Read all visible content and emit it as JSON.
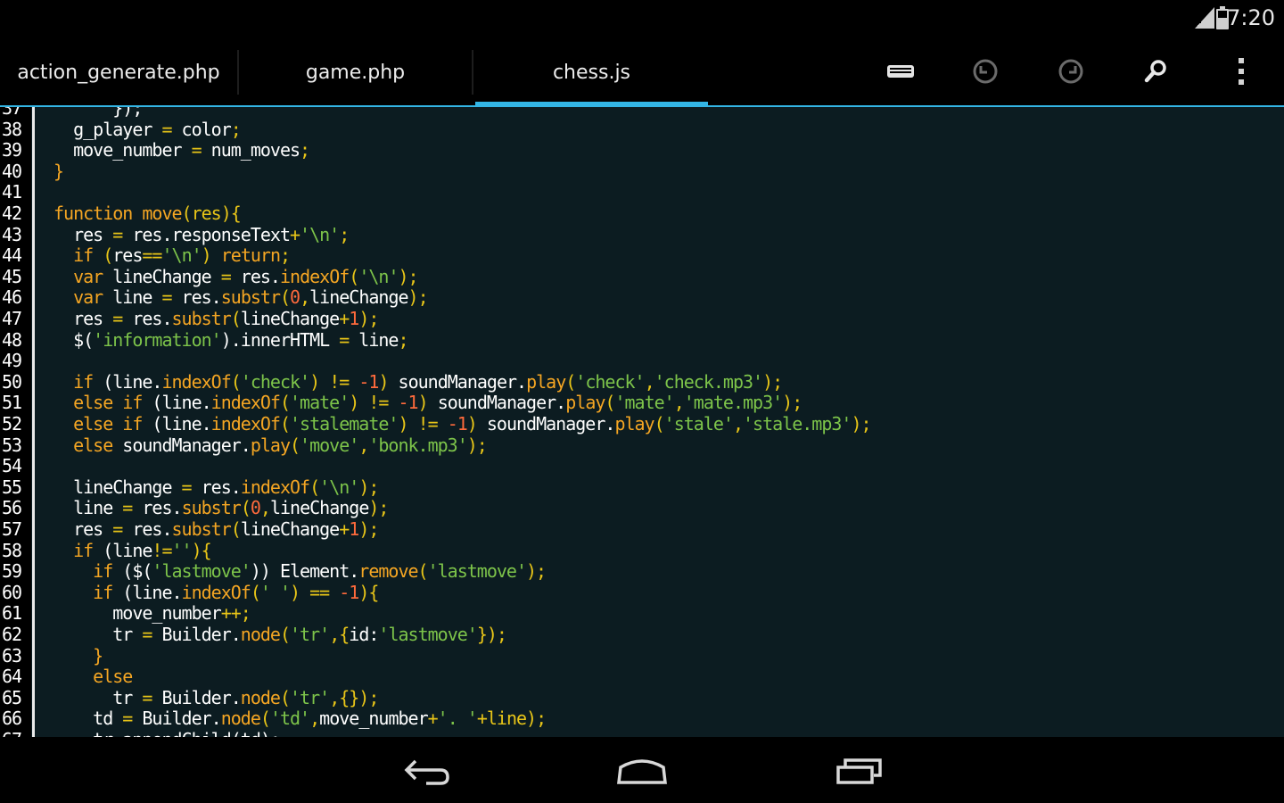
{
  "status_bar": {
    "time": "7:20"
  },
  "tabs": [
    {
      "label": "action_generate.php"
    },
    {
      "label": "game.php"
    },
    {
      "label": "chess.js"
    }
  ],
  "toolbar_icons": [
    "keyboard-icon",
    "undo-icon",
    "redo-icon",
    "search-icon",
    "overflow-menu-icon"
  ],
  "colors": {
    "accent": "#33b5e5",
    "editor_bg": "#0c1c21",
    "keyword": "#f5a623",
    "string": "#7dc44a",
    "number": "#ff6a3c"
  },
  "editor": {
    "file": "chess.js",
    "lines": [
      {
        "n": "37",
        "tokens": [
          {
            "t": "      });",
            "c": "t-p"
          }
        ]
      },
      {
        "n": "38",
        "tokens": [
          {
            "t": "  g_player ",
            "c": "t-p"
          },
          {
            "t": "=",
            "c": "t-op"
          },
          {
            "t": " color",
            "c": "t-p"
          },
          {
            "t": ";",
            "c": "t-op"
          }
        ]
      },
      {
        "n": "39",
        "tokens": [
          {
            "t": "  move_number ",
            "c": "t-p"
          },
          {
            "t": "=",
            "c": "t-op"
          },
          {
            "t": " num_moves",
            "c": "t-p"
          },
          {
            "t": ";",
            "c": "t-op"
          }
        ]
      },
      {
        "n": "40",
        "tokens": [
          {
            "t": "}",
            "c": "t-kw"
          }
        ]
      },
      {
        "n": "41",
        "tokens": []
      },
      {
        "n": "42",
        "tokens": [
          {
            "t": "function",
            "c": "t-kw"
          },
          {
            "t": " ",
            "c": "t-p"
          },
          {
            "t": "move",
            "c": "t-m"
          },
          {
            "t": "(res){",
            "c": "t-op"
          }
        ]
      },
      {
        "n": "43",
        "tokens": [
          {
            "t": "  res ",
            "c": "t-p"
          },
          {
            "t": "=",
            "c": "t-op"
          },
          {
            "t": " res.responseText",
            "c": "t-p"
          },
          {
            "t": "+",
            "c": "t-op"
          },
          {
            "t": "'\\n'",
            "c": "t-str"
          },
          {
            "t": ";",
            "c": "t-op"
          }
        ]
      },
      {
        "n": "44",
        "tokens": [
          {
            "t": "  if",
            "c": "t-kw"
          },
          {
            "t": " (",
            "c": "t-op"
          },
          {
            "t": "res",
            "c": "t-p"
          },
          {
            "t": "==",
            "c": "t-op"
          },
          {
            "t": "'\\n'",
            "c": "t-str"
          },
          {
            "t": ") ",
            "c": "t-op"
          },
          {
            "t": "return",
            "c": "t-kw"
          },
          {
            "t": ";",
            "c": "t-op"
          }
        ]
      },
      {
        "n": "45",
        "tokens": [
          {
            "t": "  var",
            "c": "t-kw"
          },
          {
            "t": " lineChange ",
            "c": "t-p"
          },
          {
            "t": "=",
            "c": "t-op"
          },
          {
            "t": " res.",
            "c": "t-p"
          },
          {
            "t": "indexOf",
            "c": "t-m"
          },
          {
            "t": "(",
            "c": "t-op"
          },
          {
            "t": "'\\n'",
            "c": "t-str"
          },
          {
            "t": ");",
            "c": "t-op"
          }
        ]
      },
      {
        "n": "46",
        "tokens": [
          {
            "t": "  var",
            "c": "t-kw"
          },
          {
            "t": " line ",
            "c": "t-p"
          },
          {
            "t": "=",
            "c": "t-op"
          },
          {
            "t": " res.",
            "c": "t-p"
          },
          {
            "t": "substr",
            "c": "t-m"
          },
          {
            "t": "(",
            "c": "t-op"
          },
          {
            "t": "0",
            "c": "t-num"
          },
          {
            "t": ",",
            "c": "t-op"
          },
          {
            "t": "lineChange",
            "c": "t-p"
          },
          {
            "t": ");",
            "c": "t-op"
          }
        ]
      },
      {
        "n": "47",
        "tokens": [
          {
            "t": "  res ",
            "c": "t-p"
          },
          {
            "t": "=",
            "c": "t-op"
          },
          {
            "t": " res.",
            "c": "t-p"
          },
          {
            "t": "substr",
            "c": "t-m"
          },
          {
            "t": "(",
            "c": "t-op"
          },
          {
            "t": "lineChange",
            "c": "t-p"
          },
          {
            "t": "+",
            "c": "t-op"
          },
          {
            "t": "1",
            "c": "t-num"
          },
          {
            "t": ");",
            "c": "t-op"
          }
        ]
      },
      {
        "n": "48",
        "tokens": [
          {
            "t": "  $(",
            "c": "t-p"
          },
          {
            "t": "'information'",
            "c": "t-str"
          },
          {
            "t": ").innerHTML ",
            "c": "t-p"
          },
          {
            "t": "=",
            "c": "t-op"
          },
          {
            "t": " line",
            "c": "t-p"
          },
          {
            "t": ";",
            "c": "t-op"
          }
        ]
      },
      {
        "n": "49",
        "tokens": []
      },
      {
        "n": "50",
        "tokens": [
          {
            "t": "  if",
            "c": "t-kw"
          },
          {
            "t": " (line.",
            "c": "t-p"
          },
          {
            "t": "indexOf",
            "c": "t-m"
          },
          {
            "t": "(",
            "c": "t-op"
          },
          {
            "t": "'check'",
            "c": "t-str"
          },
          {
            "t": ") ",
            "c": "t-op"
          },
          {
            "t": "!=",
            "c": "t-op"
          },
          {
            "t": " ",
            "c": "t-p"
          },
          {
            "t": "-1",
            "c": "t-num"
          },
          {
            "t": ") ",
            "c": "t-op"
          },
          {
            "t": "soundManager.",
            "c": "t-p"
          },
          {
            "t": "play",
            "c": "t-m"
          },
          {
            "t": "(",
            "c": "t-op"
          },
          {
            "t": "'check'",
            "c": "t-str"
          },
          {
            "t": ",",
            "c": "t-op"
          },
          {
            "t": "'check.mp3'",
            "c": "t-str"
          },
          {
            "t": ");",
            "c": "t-op"
          }
        ]
      },
      {
        "n": "51",
        "tokens": [
          {
            "t": "  else if",
            "c": "t-kw"
          },
          {
            "t": " (line.",
            "c": "t-p"
          },
          {
            "t": "indexOf",
            "c": "t-m"
          },
          {
            "t": "(",
            "c": "t-op"
          },
          {
            "t": "'mate'",
            "c": "t-str"
          },
          {
            "t": ") ",
            "c": "t-op"
          },
          {
            "t": "!=",
            "c": "t-op"
          },
          {
            "t": " ",
            "c": "t-p"
          },
          {
            "t": "-1",
            "c": "t-num"
          },
          {
            "t": ") ",
            "c": "t-op"
          },
          {
            "t": "soundManager.",
            "c": "t-p"
          },
          {
            "t": "play",
            "c": "t-m"
          },
          {
            "t": "(",
            "c": "t-op"
          },
          {
            "t": "'mate'",
            "c": "t-str"
          },
          {
            "t": ",",
            "c": "t-op"
          },
          {
            "t": "'mate.mp3'",
            "c": "t-str"
          },
          {
            "t": ");",
            "c": "t-op"
          }
        ]
      },
      {
        "n": "52",
        "tokens": [
          {
            "t": "  else if",
            "c": "t-kw"
          },
          {
            "t": " (line.",
            "c": "t-p"
          },
          {
            "t": "indexOf",
            "c": "t-m"
          },
          {
            "t": "(",
            "c": "t-op"
          },
          {
            "t": "'stalemate'",
            "c": "t-str"
          },
          {
            "t": ") ",
            "c": "t-op"
          },
          {
            "t": "!=",
            "c": "t-op"
          },
          {
            "t": " ",
            "c": "t-p"
          },
          {
            "t": "-1",
            "c": "t-num"
          },
          {
            "t": ") ",
            "c": "t-op"
          },
          {
            "t": "soundManager.",
            "c": "t-p"
          },
          {
            "t": "play",
            "c": "t-m"
          },
          {
            "t": "(",
            "c": "t-op"
          },
          {
            "t": "'stale'",
            "c": "t-str"
          },
          {
            "t": ",",
            "c": "t-op"
          },
          {
            "t": "'stale.mp3'",
            "c": "t-str"
          },
          {
            "t": ");",
            "c": "t-op"
          }
        ]
      },
      {
        "n": "53",
        "tokens": [
          {
            "t": "  else",
            "c": "t-kw"
          },
          {
            "t": " soundManager.",
            "c": "t-p"
          },
          {
            "t": "play",
            "c": "t-m"
          },
          {
            "t": "(",
            "c": "t-op"
          },
          {
            "t": "'move'",
            "c": "t-str"
          },
          {
            "t": ",",
            "c": "t-op"
          },
          {
            "t": "'bonk.mp3'",
            "c": "t-str"
          },
          {
            "t": ");",
            "c": "t-op"
          }
        ]
      },
      {
        "n": "54",
        "tokens": []
      },
      {
        "n": "55",
        "tokens": [
          {
            "t": "  lineChange ",
            "c": "t-p"
          },
          {
            "t": "=",
            "c": "t-op"
          },
          {
            "t": " res.",
            "c": "t-p"
          },
          {
            "t": "indexOf",
            "c": "t-m"
          },
          {
            "t": "(",
            "c": "t-op"
          },
          {
            "t": "'\\n'",
            "c": "t-str"
          },
          {
            "t": ");",
            "c": "t-op"
          }
        ]
      },
      {
        "n": "56",
        "tokens": [
          {
            "t": "  line ",
            "c": "t-p"
          },
          {
            "t": "=",
            "c": "t-op"
          },
          {
            "t": " res.",
            "c": "t-p"
          },
          {
            "t": "substr",
            "c": "t-m"
          },
          {
            "t": "(",
            "c": "t-op"
          },
          {
            "t": "0",
            "c": "t-num"
          },
          {
            "t": ",",
            "c": "t-op"
          },
          {
            "t": "lineChange",
            "c": "t-p"
          },
          {
            "t": ");",
            "c": "t-op"
          }
        ]
      },
      {
        "n": "57",
        "tokens": [
          {
            "t": "  res ",
            "c": "t-p"
          },
          {
            "t": "=",
            "c": "t-op"
          },
          {
            "t": " res.",
            "c": "t-p"
          },
          {
            "t": "substr",
            "c": "t-m"
          },
          {
            "t": "(",
            "c": "t-op"
          },
          {
            "t": "lineChange",
            "c": "t-p"
          },
          {
            "t": "+",
            "c": "t-op"
          },
          {
            "t": "1",
            "c": "t-num"
          },
          {
            "t": ");",
            "c": "t-op"
          }
        ]
      },
      {
        "n": "58",
        "tokens": [
          {
            "t": "  if",
            "c": "t-kw"
          },
          {
            "t": " (line",
            "c": "t-p"
          },
          {
            "t": "!=",
            "c": "t-op"
          },
          {
            "t": "''",
            "c": "t-str"
          },
          {
            "t": "){",
            "c": "t-op"
          }
        ]
      },
      {
        "n": "59",
        "tokens": [
          {
            "t": "    if",
            "c": "t-kw"
          },
          {
            "t": " ($(",
            "c": "t-p"
          },
          {
            "t": "'lastmove'",
            "c": "t-str"
          },
          {
            "t": ")) Element.",
            "c": "t-p"
          },
          {
            "t": "remove",
            "c": "t-m"
          },
          {
            "t": "(",
            "c": "t-op"
          },
          {
            "t": "'lastmove'",
            "c": "t-str"
          },
          {
            "t": ");",
            "c": "t-op"
          }
        ]
      },
      {
        "n": "60",
        "tokens": [
          {
            "t": "    if",
            "c": "t-kw"
          },
          {
            "t": " (line.",
            "c": "t-p"
          },
          {
            "t": "indexOf",
            "c": "t-m"
          },
          {
            "t": "(",
            "c": "t-op"
          },
          {
            "t": "' '",
            "c": "t-str"
          },
          {
            "t": ") ",
            "c": "t-op"
          },
          {
            "t": "==",
            "c": "t-op"
          },
          {
            "t": " ",
            "c": "t-p"
          },
          {
            "t": "-1",
            "c": "t-num"
          },
          {
            "t": "){",
            "c": "t-op"
          }
        ]
      },
      {
        "n": "61",
        "tokens": [
          {
            "t": "      move_number",
            "c": "t-p"
          },
          {
            "t": "++;",
            "c": "t-op"
          }
        ]
      },
      {
        "n": "62",
        "tokens": [
          {
            "t": "      tr ",
            "c": "t-p"
          },
          {
            "t": "=",
            "c": "t-op"
          },
          {
            "t": " Builder.",
            "c": "t-p"
          },
          {
            "t": "node",
            "c": "t-m"
          },
          {
            "t": "(",
            "c": "t-op"
          },
          {
            "t": "'tr'",
            "c": "t-str"
          },
          {
            "t": ",{",
            "c": "t-op"
          },
          {
            "t": "id:",
            "c": "t-p"
          },
          {
            "t": "'lastmove'",
            "c": "t-str"
          },
          {
            "t": "});",
            "c": "t-op"
          }
        ]
      },
      {
        "n": "63",
        "tokens": [
          {
            "t": "    }",
            "c": "t-kw"
          }
        ]
      },
      {
        "n": "64",
        "tokens": [
          {
            "t": "    else",
            "c": "t-kw"
          }
        ]
      },
      {
        "n": "65",
        "tokens": [
          {
            "t": "      tr ",
            "c": "t-p"
          },
          {
            "t": "=",
            "c": "t-op"
          },
          {
            "t": " Builder.",
            "c": "t-p"
          },
          {
            "t": "node",
            "c": "t-m"
          },
          {
            "t": "(",
            "c": "t-op"
          },
          {
            "t": "'tr'",
            "c": "t-str"
          },
          {
            "t": ",{});",
            "c": "t-op"
          }
        ]
      },
      {
        "n": "66",
        "tokens": [
          {
            "t": "    td ",
            "c": "t-p"
          },
          {
            "t": "=",
            "c": "t-op"
          },
          {
            "t": " Builder.",
            "c": "t-p"
          },
          {
            "t": "node",
            "c": "t-m"
          },
          {
            "t": "(",
            "c": "t-op"
          },
          {
            "t": "'td'",
            "c": "t-str"
          },
          {
            "t": ",",
            "c": "t-op"
          },
          {
            "t": "move_number",
            "c": "t-p"
          },
          {
            "t": "+",
            "c": "t-op"
          },
          {
            "t": "'. '",
            "c": "t-str"
          },
          {
            "t": "+",
            "c": "t-op"
          },
          {
            "t": "line);",
            "c": "t-op"
          }
        ]
      },
      {
        "n": "67",
        "tokens": [
          {
            "t": "    tr.appendChild(td);",
            "c": "t-p"
          }
        ]
      }
    ]
  }
}
